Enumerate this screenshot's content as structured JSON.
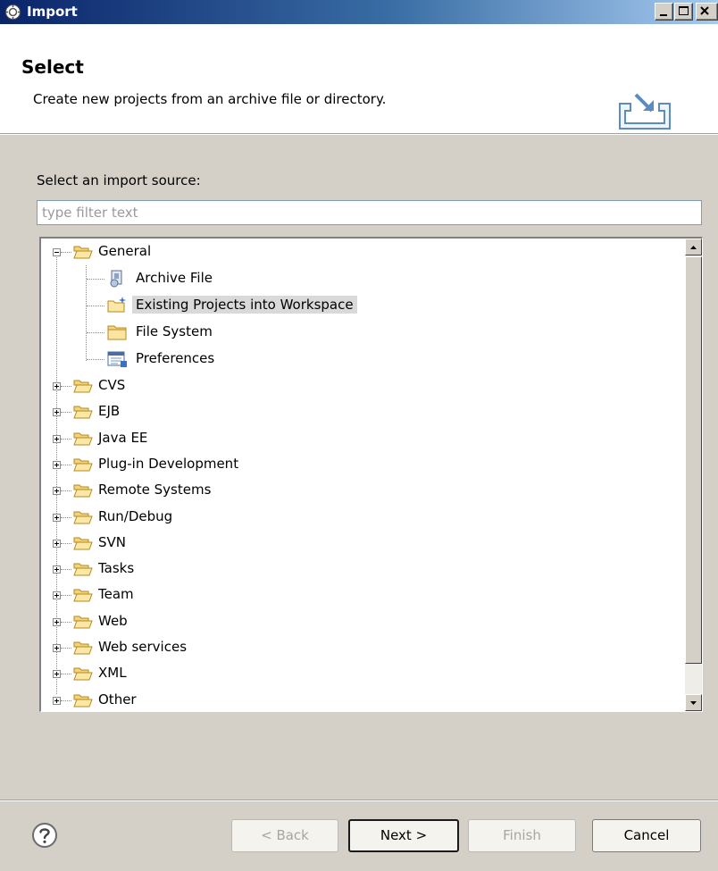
{
  "window": {
    "title": "Import"
  },
  "header": {
    "heading": "Select",
    "description": "Create new projects from an archive file or directory."
  },
  "source": {
    "label": "Select an import source:",
    "filter_placeholder": "type filter text",
    "filter_value": ""
  },
  "tree": {
    "general": {
      "label": "General",
      "expanded": true,
      "children": [
        {
          "label": "Archive File",
          "icon": "archive-file-icon"
        },
        {
          "label": "Existing Projects into Workspace",
          "icon": "existing-project-icon",
          "selected": true
        },
        {
          "label": "File System",
          "icon": "folder-icon"
        },
        {
          "label": "Preferences",
          "icon": "preferences-icon"
        }
      ]
    },
    "categories": [
      "CVS",
      "EJB",
      "Java EE",
      "Plug-in Development",
      "Remote Systems",
      "Run/Debug",
      "SVN",
      "Tasks",
      "Team",
      "Web",
      "Web services",
      "XML",
      "Other"
    ]
  },
  "buttons": {
    "back": "< Back",
    "next": "Next >",
    "finish": "Finish",
    "cancel": "Cancel"
  },
  "colors": {
    "titlebar_start": "#0a246a",
    "titlebar_end": "#a6caf0",
    "dialog_bg": "#d4d0c8",
    "selection": "#d9d9d9"
  }
}
